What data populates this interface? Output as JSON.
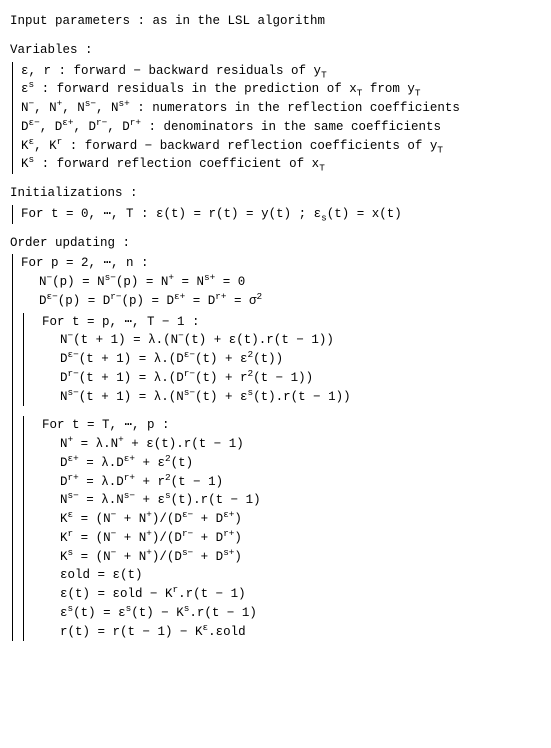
{
  "header_input": "Input parameters : as in the LSL algorithm",
  "variables_title": "Variables :",
  "variables": {
    "l1": "ε, r : forward − backward residuals  of y",
    "l1_sub": "T",
    "l2a": "ε",
    "l2sup": "s",
    "l2b": " : forward residuals in the prediction of x",
    "l2sub1": "T",
    "l2c": " from y",
    "l2sub2": "T",
    "l3a": "N",
    "l3sup1": "−",
    "l3b": ", N",
    "l3sup2": "+",
    "l3c": ", N",
    "l3sup3": "s−",
    "l3d": ", N",
    "l3sup4": "s+",
    "l3e": " : numerators in the reflection coefficients",
    "l4a": "D",
    "l4sup1": "ε−",
    "l4b": ", D",
    "l4sup2": "ε+",
    "l4c": ", D",
    "l4sup3": "r−",
    "l4d": ", D",
    "l4sup4": "r+",
    "l4e": " : denominators in the same coefficients",
    "l5a": "K",
    "l5sup1": "ε",
    "l5b": ", K",
    "l5sup2": "r",
    "l5c": " : forward − backward reflection coefficients of y",
    "l5sub": "T",
    "l6a": "K",
    "l6sup": "s",
    "l6b": " : forward reflection coefficient of x",
    "l6sub": "T"
  },
  "init_title": "Initializations :",
  "init_line_a": "For t = 0, ⋯, T :  ε(t) = r(t) = y(t) ;  ε",
  "init_line_sub": "s",
  "init_line_b": "(t) = x(t)",
  "order_title": "Order updating :",
  "order": {
    "for_p": "For p = 2, ⋯, n :",
    "nline_a": "N",
    "nline_s1": "−",
    "nline_b": "(p) = N",
    "nline_s2": "s−",
    "nline_c": "(p) = N",
    "nline_s3": "+",
    "nline_d": " = N",
    "nline_s4": "s+",
    "nline_e": " = 0",
    "dline_a": "D",
    "dline_s1": "ε−",
    "dline_b": "(p) = D",
    "dline_s2": "r−",
    "dline_c": "(p) = D",
    "dline_s3": "ε+",
    "dline_d": " = D",
    "dline_s4": "r+",
    "dline_e": " = σ",
    "dline_s5": "2",
    "inner1": {
      "for_t": "For t = p, ⋯, T − 1 :",
      "l1": "N−(t + 1) = λ.(N−(t) + ε(t).r(t − 1))",
      "l2": "Dε−(t + 1) = λ.(Dε−(t) + ε2(t))",
      "l3": "Dr−(t + 1) = λ.(Dr−(t) + r2(t − 1))",
      "l4": "Ns−(t + 1) = λ.(Ns−(t) + εs(t).r(t − 1))"
    },
    "inner2": {
      "for_t": "For t = T, ⋯, p :",
      "l1": "N+ = λ.N+ + ε(t).r(t − 1)",
      "l2": "Dε+ = λ.Dε+ + ε2(t)",
      "l3": "Dr+ = λ.Dr+ + r2(t − 1)",
      "l4": "Ns− = λ.Ns− + εs(t).r(t − 1)",
      "l5": "Kε = (N− + N+)/(Dε− + Dε+)",
      "l6": "Kr = (N− + N+)/(Dr− + Dr+)",
      "l7": "Ks = (N− + N+)/(Ds− + Ds+)",
      "l8": "εold = ε(t)",
      "l9": "ε(t) = εold − Kr.r(t − 1)",
      "l10": "εs(t) = εs(t) − Ks.r(t − 1)",
      "l11": "r(t) = r(t − 1) − Kε.εold"
    }
  }
}
